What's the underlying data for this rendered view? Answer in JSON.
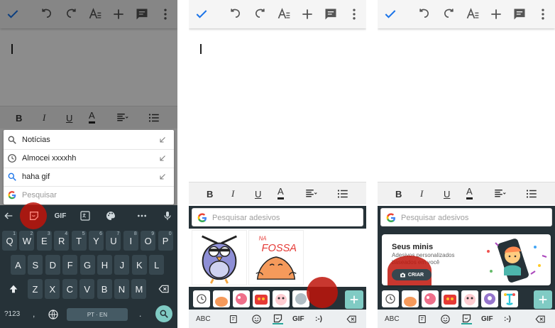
{
  "colors": {
    "accent_blue": "#1a73e8",
    "keyboard_bg": "#263238",
    "key_bg": "#37474f",
    "teal": "#80cbc4",
    "highlight_red": "#be140a"
  },
  "icons": [
    "check-icon",
    "undo-icon",
    "redo-icon",
    "text-format-icon",
    "add-icon",
    "comment-icon",
    "more-vert-icon",
    "bold-icon",
    "italic-icon",
    "underline-icon",
    "text-color-icon",
    "align-icon",
    "list-icon",
    "search-icon",
    "history-icon",
    "google-g-icon",
    "arrow-insert-icon",
    "back-arrow-icon",
    "sticker-icon",
    "translate-icon",
    "palette-icon",
    "more-horiz-icon",
    "mic-icon",
    "shift-icon",
    "backspace-icon",
    "globe-icon",
    "enter-icon",
    "camera-icon",
    "smile-icon"
  ],
  "formatting": {
    "bold": "B",
    "italic": "I",
    "underline": "U",
    "text_color": "A"
  },
  "panel1": {
    "suggestions": [
      {
        "text": "Notícias",
        "icon": "search-icon"
      },
      {
        "text": "Almocei xxxxhh",
        "icon": "history-icon"
      },
      {
        "text": "haha gif",
        "icon": "search-icon"
      }
    ],
    "search_placeholder": "Pesquisar",
    "toolbar": {
      "gif_label": "GIF",
      "more_label": "..."
    },
    "keyboard": {
      "row1": [
        {
          "k": "Q",
          "a": "1"
        },
        {
          "k": "W",
          "a": "2"
        },
        {
          "k": "E",
          "a": "3"
        },
        {
          "k": "R",
          "a": "4"
        },
        {
          "k": "T",
          "a": "5"
        },
        {
          "k": "Y",
          "a": "6"
        },
        {
          "k": "U",
          "a": "7"
        },
        {
          "k": "I",
          "a": "8"
        },
        {
          "k": "O",
          "a": "9"
        },
        {
          "k": "P",
          "a": "0"
        }
      ],
      "row2": [
        "A",
        "S",
        "D",
        "F",
        "G",
        "H",
        "J",
        "K",
        "L"
      ],
      "row3": [
        "Z",
        "X",
        "C",
        "V",
        "B",
        "N",
        "M"
      ],
      "symbols_label": "?123",
      "comma_label": ",",
      "period_label": ".",
      "space_label": "PT · EN"
    }
  },
  "panel2": {
    "search_placeholder": "Pesquisar adesivos",
    "sticker_text": "NA FOSSA",
    "tabs": {
      "abc": "ABC",
      "gif": "GIF",
      "emoticon": ":-)"
    }
  },
  "panel3": {
    "search_placeholder": "Pesquisar adesivos",
    "card_title": "Seus minis",
    "card_desc": "Adesivos personalizados baseados em você",
    "criar_label": "CRIAR",
    "tabs": {
      "abc": "ABC",
      "gif": "GIF",
      "emoticon": ":-)"
    }
  }
}
